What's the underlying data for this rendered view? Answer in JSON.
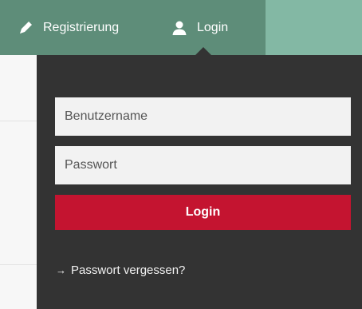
{
  "nav": {
    "register_label": "Registrierung",
    "register_icon": "pencil-icon",
    "login_label": "Login",
    "login_icon": "user-icon"
  },
  "login_form": {
    "username_placeholder": "Benutzername",
    "password_placeholder": "Passwort",
    "submit_label": "Login",
    "forgot_label": "Passwort vergessen?",
    "forgot_icon": "arrow-right-icon"
  },
  "colors": {
    "nav_background": "#5e8d79",
    "header_background": "#83b8a4",
    "dropdown_background": "#333333",
    "login_button": "#c41430",
    "input_background": "#f2f2f2"
  }
}
